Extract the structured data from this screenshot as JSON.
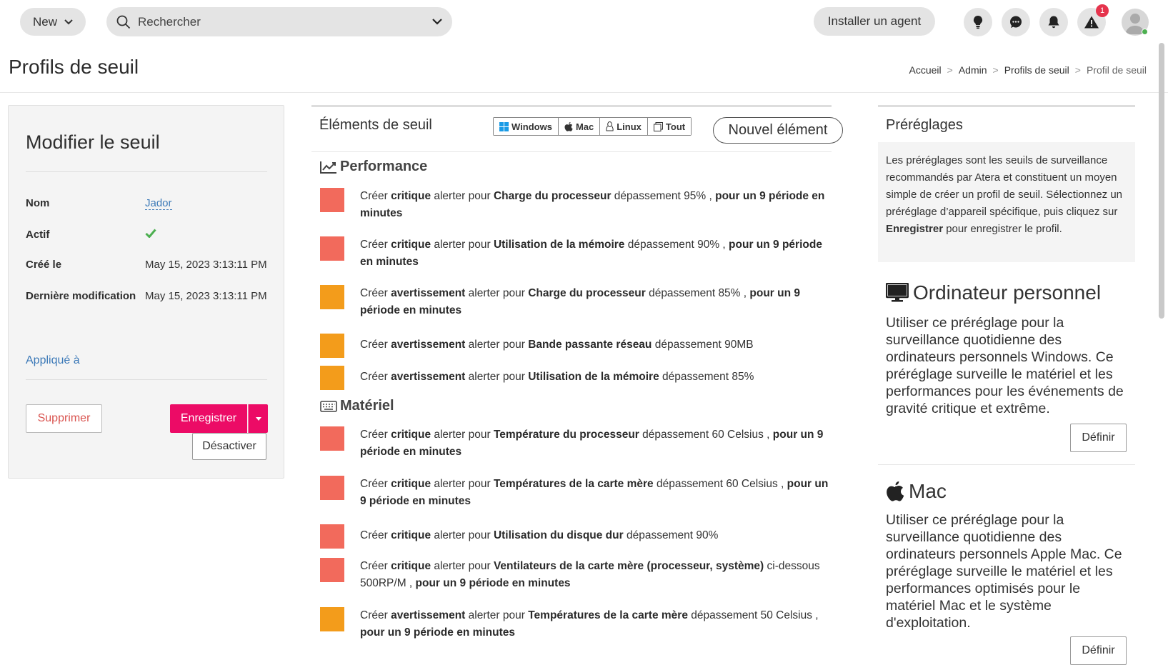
{
  "topbar": {
    "new_label": "New",
    "search_placeholder": "Rechercher",
    "install_agent_label": "Installer un agent",
    "alerts_badge": "1"
  },
  "page": {
    "title": "Profils de seuil",
    "breadcrumb": [
      "Accueil",
      "Admin",
      "Profils de seuil",
      "Profil de seuil"
    ]
  },
  "edit_panel": {
    "title": "Modifier le seuil",
    "name_label": "Nom",
    "name_value": "Jador",
    "active_label": "Actif",
    "created_label": "Créé le",
    "created_value": "May 15, 2023 3:13:11 PM",
    "modified_label": "Dernière modification",
    "modified_value": "May 15, 2023 3:13:11 PM",
    "applied_to_label": "Appliqué à",
    "delete_label": "Supprimer",
    "save_label": "Enregistrer",
    "deactivate_label": "Désactiver",
    "active_check_color": "#4caf50"
  },
  "elements_panel": {
    "title": "Éléments de seuil",
    "filters": [
      "Windows",
      "Mac",
      "Linux",
      "Tout"
    ],
    "new_element_label": "Nouvel élément",
    "sections": [
      {
        "heading": "Performance",
        "rules": [
          {
            "severity": "critical",
            "pre": "Créer ",
            "level": "critique",
            "mid": " alerter pour ",
            "metric": "Charge du processeur",
            "cond": " dépassement 95% , ",
            "period": "pour un 9 période en minutes"
          },
          {
            "severity": "critical",
            "pre": "Créer ",
            "level": "critique",
            "mid": " alerter pour ",
            "metric": "Utilisation de la mémoire",
            "cond": " dépassement 90% , ",
            "period": "pour un 9 période en minutes"
          },
          {
            "severity": "warning",
            "pre": "Créer ",
            "level": "avertissement",
            "mid": " alerter pour ",
            "metric": "Charge du processeur",
            "cond": " dépassement 85% , ",
            "period": "pour un 9 période en minutes"
          },
          {
            "severity": "warning",
            "pre": "Créer ",
            "level": "avertissement",
            "mid": " alerter pour ",
            "metric": "Bande passante réseau",
            "cond": " dépassement 90MB",
            "period": ""
          },
          {
            "severity": "warning",
            "pre": "Créer ",
            "level": "avertissement",
            "mid": " alerter pour ",
            "metric": "Utilisation de la mémoire",
            "cond": " dépassement 85%",
            "period": ""
          }
        ]
      },
      {
        "heading": "Matériel",
        "rules": [
          {
            "severity": "critical",
            "pre": "Créer ",
            "level": "critique",
            "mid": " alerter pour ",
            "metric": "Température du processeur",
            "cond": " dépassement 60 Celsius , ",
            "period": "pour un 9 période en minutes"
          },
          {
            "severity": "critical",
            "pre": "Créer ",
            "level": "critique",
            "mid": " alerter pour ",
            "metric": "Températures de la carte mère",
            "cond": " dépassement 60 Celsius , ",
            "period": "pour un 9 période en minutes"
          },
          {
            "severity": "critical",
            "pre": "Créer ",
            "level": "critique",
            "mid": " alerter pour ",
            "metric": "Utilisation du disque dur",
            "cond": " dépassement 90%",
            "period": ""
          },
          {
            "severity": "critical",
            "pre": "Créer ",
            "level": "critique",
            "mid": " alerter pour ",
            "metric": "Ventilateurs de la carte mère (processeur, système)",
            "cond": " ci-dessous 500RP/M , ",
            "period": "pour un 9 période en minutes"
          },
          {
            "severity": "warning",
            "pre": "Créer ",
            "level": "avertissement",
            "mid": " alerter pour ",
            "metric": "Températures de la carte mère",
            "cond": " dépassement 50 Celsius , ",
            "period": "pour un 9 période en minutes"
          }
        ]
      }
    ],
    "colors": {
      "critical": "#f26a5c",
      "warning": "#f39c1b"
    }
  },
  "presets_panel": {
    "title": "Préréglages",
    "info_pre": "Les préréglages sont les seuils de surveillance recommandés par Atera et constituent un moyen simple de créer un profil de seuil. Sélectionnez un préréglage d’appareil spécifique, puis cliquez sur ",
    "info_bold": "Enregistrer",
    "info_post": " pour enregistrer le profil.",
    "presets": [
      {
        "title": "Ordinateur personnel",
        "icon": "monitor-icon",
        "desc": "Utiliser ce préréglage pour la surveillance quotidienne des ordinateurs personnels Windows. Ce préréglage surveille le matériel et les performances pour les événements de gravité critique et extrême.",
        "button": "Définir"
      },
      {
        "title": "Mac",
        "icon": "apple-icon",
        "desc": "Utiliser ce préréglage pour la surveillance quotidienne des ordinateurs personnels Apple Mac. Ce préréglage surveille le matériel et les performances optimisés pour le matériel Mac et le système d'exploitation.",
        "button": "Définir"
      }
    ]
  },
  "accent_color": "#ec0b66"
}
